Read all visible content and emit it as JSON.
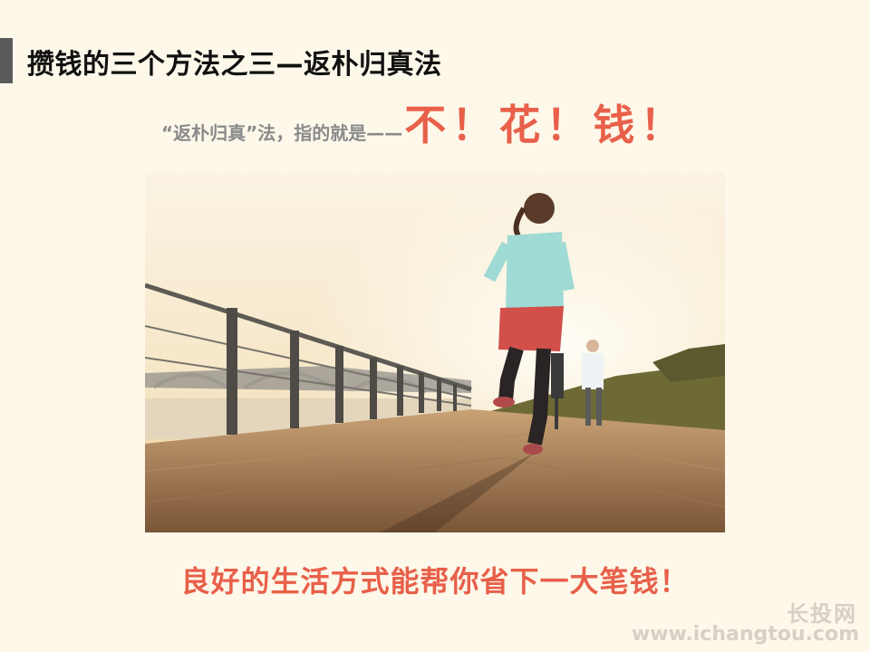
{
  "header": {
    "title": "攒钱的三个方法之三—返朴归真法"
  },
  "subtitle": {
    "lead": "“返朴归真”法，指的就是——",
    "emphasis": "不！花！钱！"
  },
  "photo": {
    "icon": "running-woman-photo"
  },
  "footer": {
    "slogan": "良好的生活方式能帮你省下一大笔钱！"
  },
  "watermark": {
    "name": "长投网",
    "url": "www.ichangtou.com"
  },
  "colors": {
    "accent": "#e8604a",
    "background": "#fdf8ea",
    "title": "#111111"
  }
}
